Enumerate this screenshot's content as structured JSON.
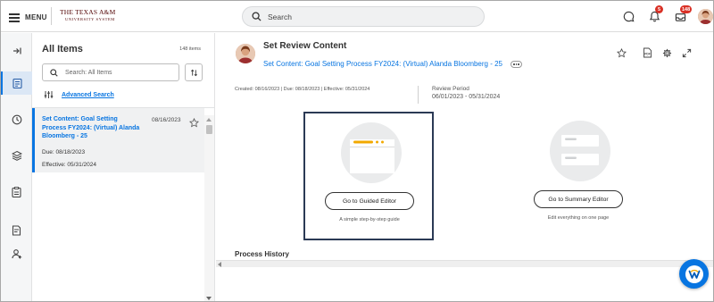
{
  "topbar": {
    "menu_label": "MENU",
    "logo_line1": "THE TEXAS A&M",
    "logo_line2": "UNIVERSITY SYSTEM",
    "search_placeholder": "Search",
    "notifications_count": "5",
    "inbox_count": "148"
  },
  "list": {
    "title": "All Items",
    "count": "148 items",
    "search_placeholder": "Search: All Items",
    "advanced_search": "Advanced Search",
    "items": [
      {
        "title": "Set Content: Goal Setting Process FY2024: (Virtual) Alanda Bloomberg - 25",
        "date": "08/16/2023",
        "due": "Due: 08/18/2023",
        "effective": "Effective: 05/31/2024"
      }
    ]
  },
  "main": {
    "title": "Set Review Content",
    "link": "Set Content: Goal Setting Process FY2024: (Virtual) Alanda Bloomberg - 25",
    "meta": "Created: 08/16/2023 | Due: 08/18/2023 | Effective: 05/31/2024",
    "review_period_label": "Review Period",
    "review_period_value": "06/01/2023 - 05/31/2024",
    "guided_button": "Go to Guided Editor",
    "guided_caption": "A simple step-by-step guide",
    "summary_button": "Go to Summary Editor",
    "summary_caption": "Edit everything on one page",
    "process_history": "Process History"
  },
  "colors": {
    "accent": "#0875e1",
    "badge": "#d93025",
    "brand": "#500000",
    "illustration_orange": "#f2a900"
  }
}
